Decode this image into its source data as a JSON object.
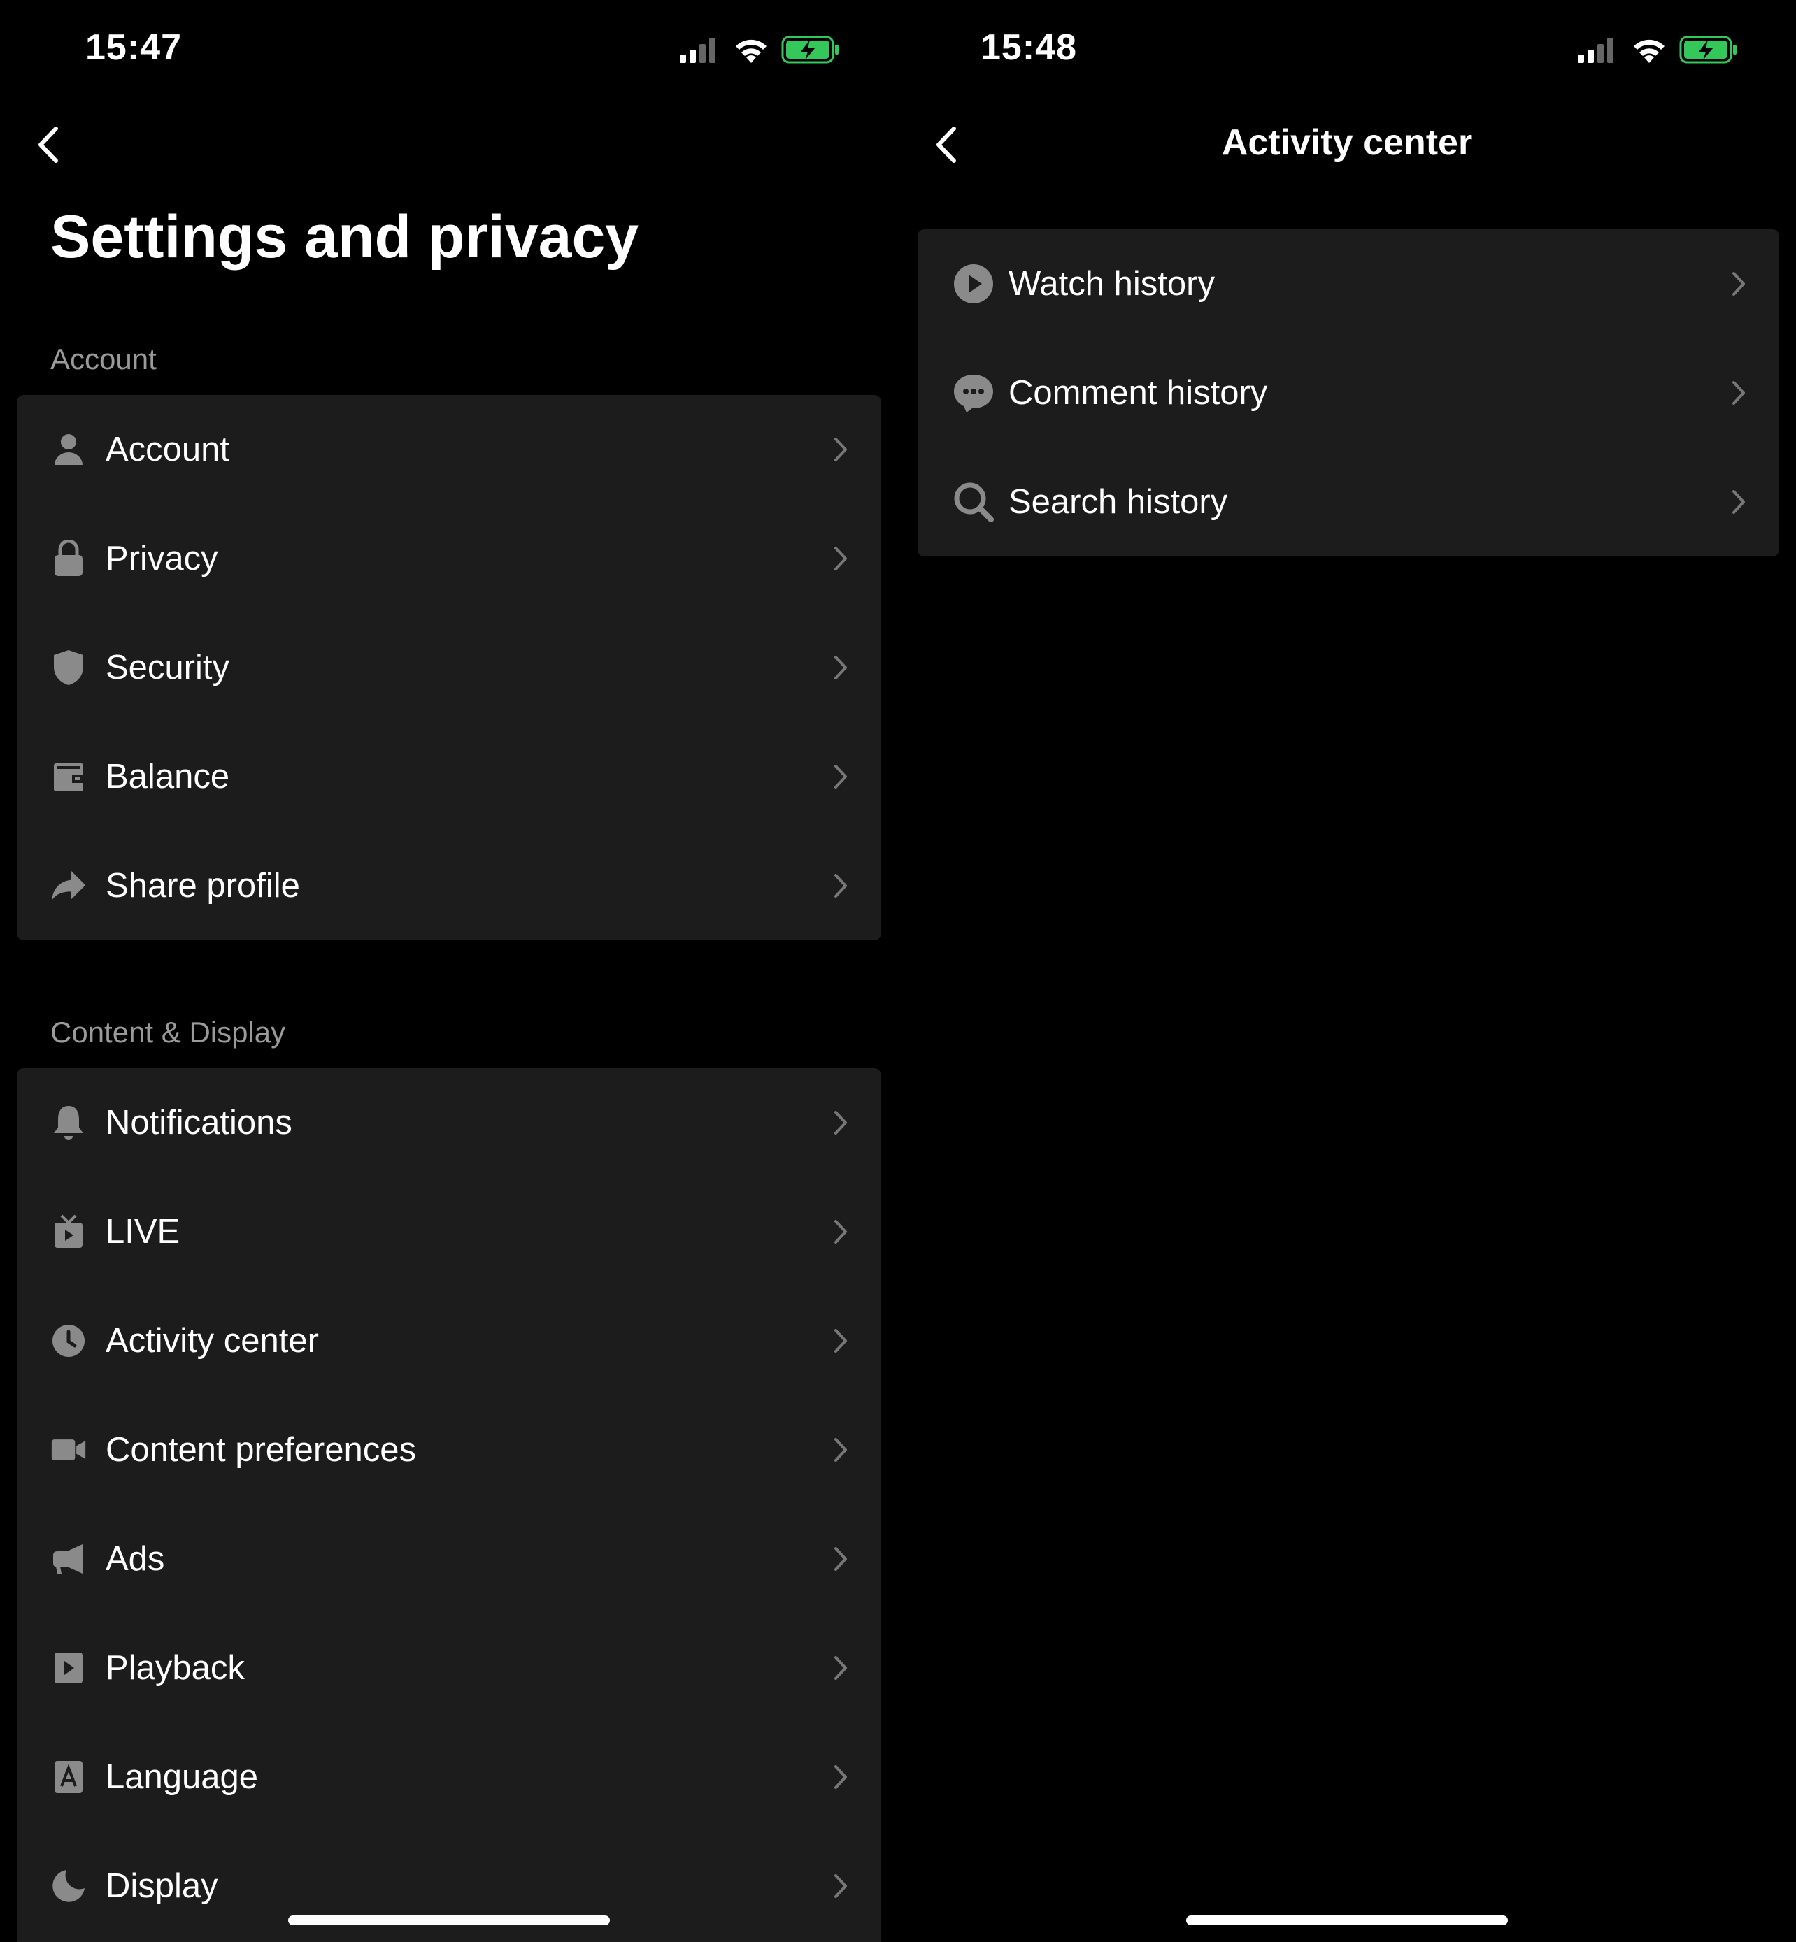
{
  "left_screen": {
    "status": {
      "time": "15:47"
    },
    "title": "Settings and privacy",
    "sections": [
      {
        "label": "Account",
        "items": [
          {
            "label": "Account",
            "icon": "person-icon"
          },
          {
            "label": "Privacy",
            "icon": "lock-icon"
          },
          {
            "label": "Security",
            "icon": "shield-icon"
          },
          {
            "label": "Balance",
            "icon": "wallet-icon"
          },
          {
            "label": "Share profile",
            "icon": "share-icon"
          }
        ]
      },
      {
        "label": "Content & Display",
        "items": [
          {
            "label": "Notifications",
            "icon": "bell-icon"
          },
          {
            "label": "LIVE",
            "icon": "tv-icon"
          },
          {
            "label": "Activity center",
            "icon": "clock-icon"
          },
          {
            "label": "Content preferences",
            "icon": "video-camera-icon"
          },
          {
            "label": "Ads",
            "icon": "megaphone-icon"
          },
          {
            "label": "Playback",
            "icon": "play-square-icon"
          },
          {
            "label": "Language",
            "icon": "language-a-icon"
          },
          {
            "label": "Display",
            "icon": "moon-icon"
          }
        ]
      }
    ]
  },
  "right_screen": {
    "status": {
      "time": "15:48"
    },
    "title": "Activity center",
    "items": [
      {
        "label": "Watch history",
        "icon": "play-circle-icon"
      },
      {
        "label": "Comment history",
        "icon": "comment-bubble-icon"
      },
      {
        "label": "Search history",
        "icon": "search-icon"
      }
    ]
  },
  "colors": {
    "background": "#000000",
    "card": "#1c1c1c",
    "secondary_text": "#9a9a9a",
    "icon": "#8a8a8a",
    "battery_fill": "#34c759"
  }
}
